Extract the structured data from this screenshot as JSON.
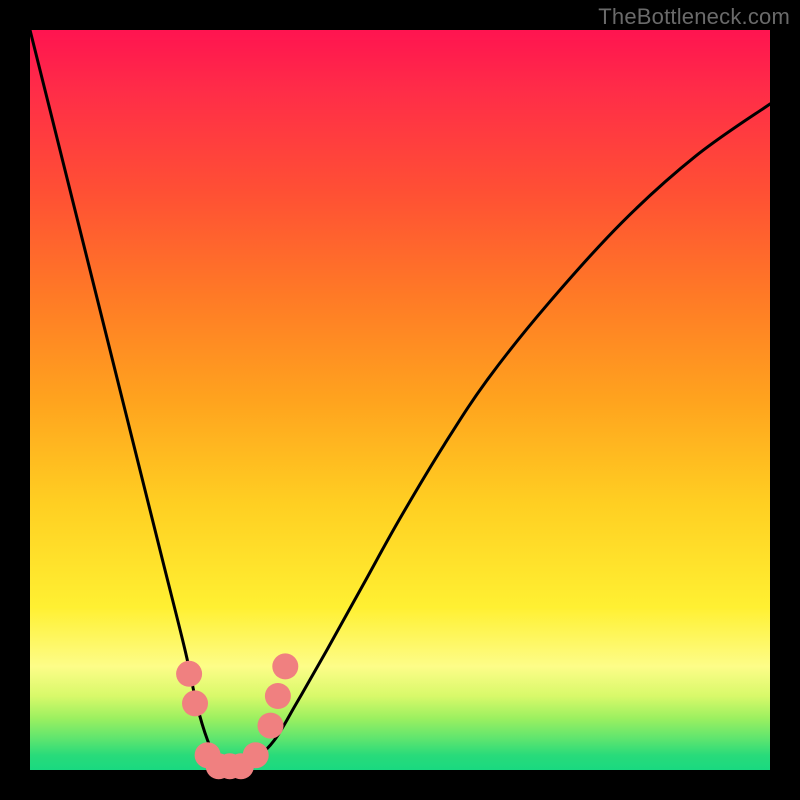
{
  "watermark": {
    "text": "TheBottleneck.com"
  },
  "chart_data": {
    "type": "line",
    "title": "",
    "xlabel": "",
    "ylabel": "",
    "xlim": [
      0,
      100
    ],
    "ylim": [
      0,
      100
    ],
    "grid": false,
    "gradient_stops": [
      {
        "pos": 0,
        "color": "#ff1450"
      },
      {
        "pos": 50,
        "color": "#ffa31e"
      },
      {
        "pos": 80,
        "color": "#fff032"
      },
      {
        "pos": 100,
        "color": "#19d980"
      }
    ],
    "series": [
      {
        "name": "bottleneck-curve",
        "style": "solid-black",
        "x": [
          0,
          3,
          6,
          9,
          12,
          15,
          18,
          21,
          22.5,
          24,
          25.5,
          27,
          28.5,
          30,
          33,
          36,
          40,
          45,
          50,
          56,
          62,
          70,
          80,
          90,
          100
        ],
        "y_pct": [
          100,
          88,
          76,
          64,
          52,
          40,
          28,
          16,
          9,
          4,
          1,
          0,
          0,
          1,
          4,
          9,
          16,
          25,
          34,
          44,
          53,
          63,
          74,
          83,
          90
        ]
      }
    ],
    "markers": {
      "name": "highlight-beads",
      "color": "#f08080",
      "radius_px": 13,
      "points": [
        {
          "x": 21.5,
          "y_pct": 13
        },
        {
          "x": 22.3,
          "y_pct": 9
        },
        {
          "x": 24.0,
          "y_pct": 2
        },
        {
          "x": 25.5,
          "y_pct": 0.5
        },
        {
          "x": 27.0,
          "y_pct": 0.5
        },
        {
          "x": 28.5,
          "y_pct": 0.5
        },
        {
          "x": 30.5,
          "y_pct": 2
        },
        {
          "x": 32.5,
          "y_pct": 6
        },
        {
          "x": 33.5,
          "y_pct": 10
        },
        {
          "x": 34.5,
          "y_pct": 14
        }
      ]
    }
  }
}
